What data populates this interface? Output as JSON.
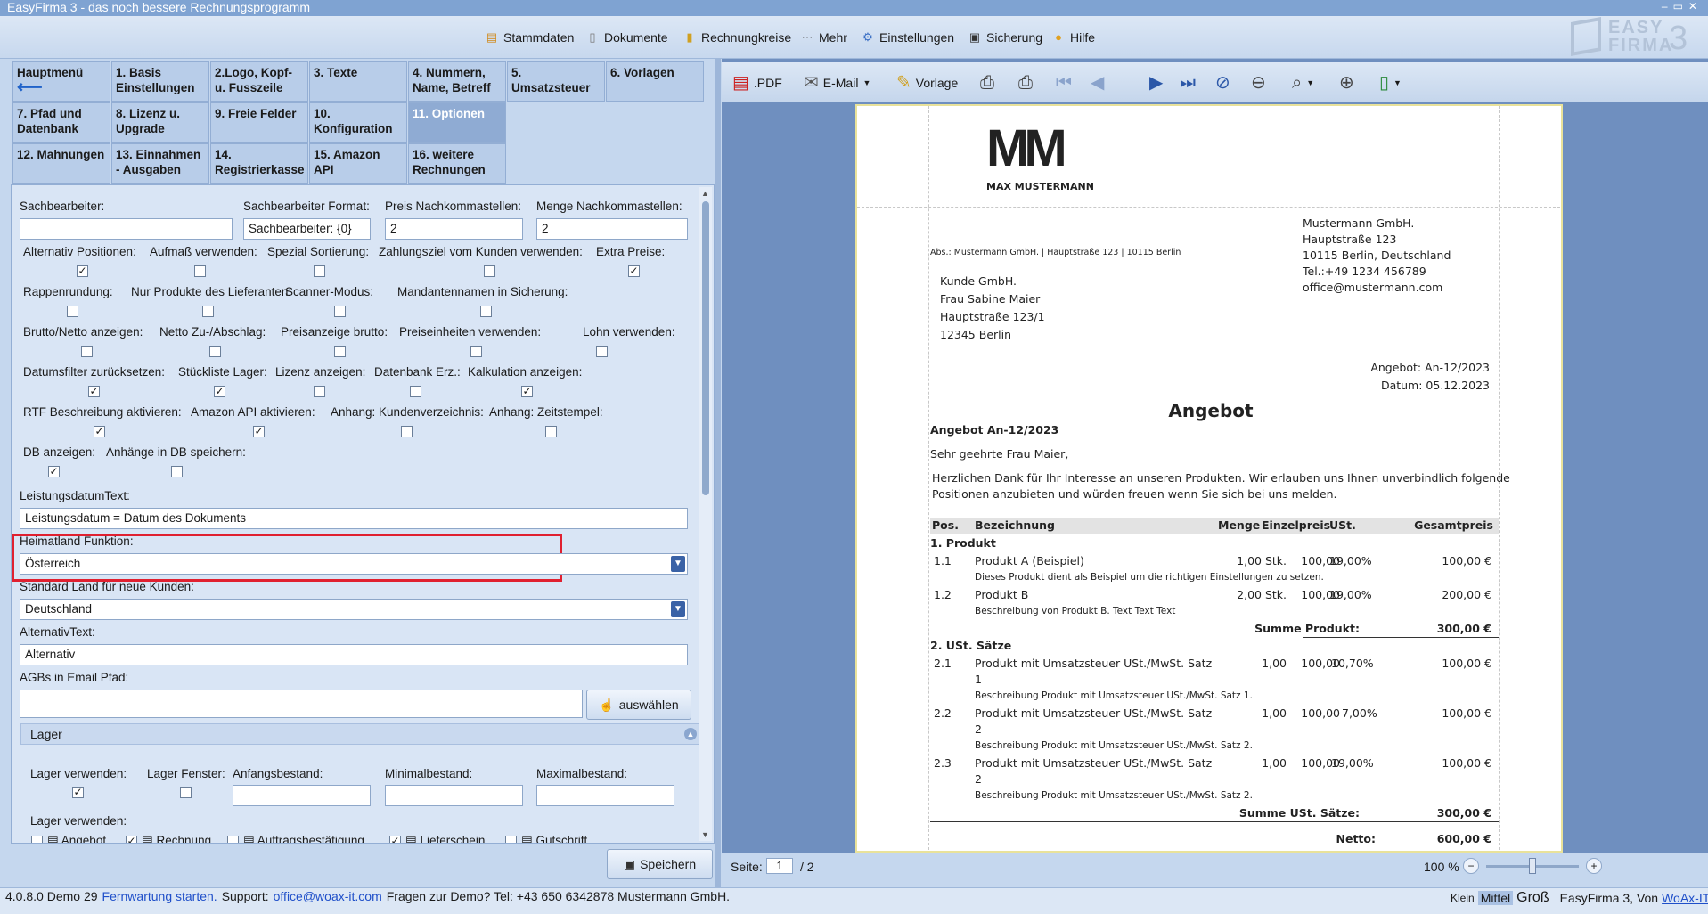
{
  "window": {
    "title": "EasyFirma 3 - das noch bessere Rechnungsprogramm"
  },
  "menu": [
    {
      "label": "Stammdaten",
      "icon": "stammdaten-icon"
    },
    {
      "label": "Dokumente",
      "icon": "document-icon"
    },
    {
      "label": "Rechnungkreise",
      "icon": "rechnungkreise-icon"
    },
    {
      "label": "Mehr",
      "icon": "more-icon"
    },
    {
      "label": "Einstellungen",
      "icon": "gear-icon"
    },
    {
      "label": "Sicherung",
      "icon": "floppy-icon"
    },
    {
      "label": "Hilfe",
      "icon": "help-icon"
    }
  ],
  "logo": {
    "line1": "EASY",
    "line2": "FIRMA",
    "number": "3"
  },
  "tabs": [
    {
      "label": "Hauptmenü"
    },
    {
      "label": "1. Basis Einstellungen"
    },
    {
      "label": "2.Logo, Kopf- u. Fusszeile"
    },
    {
      "label": "3. Texte"
    },
    {
      "label": "4. Nummern, Name, Betreff"
    },
    {
      "label": "5. Umsatzsteuer"
    },
    {
      "label": "6. Vorlagen"
    },
    {
      "label": "7. Pfad und Datenbank"
    },
    {
      "label": "8. Lizenz u. Upgrade"
    },
    {
      "label": "9. Freie Felder"
    },
    {
      "label": "10. Konfiguration"
    },
    {
      "label": "11. Optionen"
    },
    {
      "label": "12. Mahnungen"
    },
    {
      "label": "13. Einnahmen - Ausgaben"
    },
    {
      "label": "14. Registrierkasse"
    },
    {
      "label": "15. Amazon API"
    },
    {
      "label": "16. weitere Rechnungen"
    }
  ],
  "form": {
    "sachbearbeiter_label": "Sachbearbeiter:",
    "sachbearbeiter_value": "",
    "sb_format_label": "Sachbearbeiter Format:",
    "sb_format_value": "Sachbearbeiter: {0}",
    "preis_nk_label": "Preis Nachkommastellen:",
    "preis_nk_value": "2",
    "menge_nk_label": "Menge Nachkommastellen:",
    "menge_nk_value": "2",
    "checks_row1": [
      {
        "label": "Alternativ Positionen:",
        "checked": "✓"
      },
      {
        "label": "Aufmaß verwenden:",
        "checked": ""
      },
      {
        "label": "Spezial Sortierung:",
        "checked": ""
      },
      {
        "label": "Zahlungsziel vom Kunden verwenden:",
        "checked": ""
      },
      {
        "label": "Extra Preise:",
        "checked": "✓"
      }
    ],
    "checks_row2": [
      {
        "label": "Rappenrundung:",
        "checked": ""
      },
      {
        "label": "Nur Produkte des Lieferanten:",
        "checked": ""
      },
      {
        "label": "Scanner-Modus:",
        "checked": ""
      },
      {
        "label": "Mandantennamen in Sicherung:",
        "checked": ""
      }
    ],
    "checks_row3": [
      {
        "label": "Brutto/Netto anzeigen:",
        "checked": ""
      },
      {
        "label": "Netto Zu-/Abschlag:",
        "checked": ""
      },
      {
        "label": "Preisanzeige brutto:",
        "checked": ""
      },
      {
        "label": "Preiseinheiten verwenden:",
        "checked": ""
      },
      {
        "label": "Lohn verwenden:",
        "checked": ""
      }
    ],
    "checks_row4": [
      {
        "label": "Datumsfilter zurücksetzen:",
        "checked": "✓"
      },
      {
        "label": "Stückliste Lager:",
        "checked": "✓"
      },
      {
        "label": "Lizenz anzeigen:",
        "checked": ""
      },
      {
        "label": "Datenbank Erz.:",
        "checked": ""
      },
      {
        "label": "Kalkulation anzeigen:",
        "checked": "✓"
      }
    ],
    "checks_row5": [
      {
        "label": "RTF Beschreibung aktivieren:",
        "checked": "✓"
      },
      {
        "label": "Amazon API aktivieren:",
        "checked": "✓"
      },
      {
        "label": "Anhang: Kundenverzeichnis:",
        "checked": ""
      },
      {
        "label": "Anhang: Zeitstempel:",
        "checked": ""
      }
    ],
    "checks_row6": [
      {
        "label": "DB anzeigen:",
        "checked": "✓"
      },
      {
        "label": "Anhänge in DB speichern:",
        "checked": ""
      }
    ],
    "leistungsdatum_label": "LeistungsdatumText:",
    "leistungsdatum_value": "Leistungsdatum = Datum des Dokuments",
    "heimatland_label": "Heimatland Funktion:",
    "heimatland_value": "Österreich",
    "standardland_label": "Standard Land für neue Kunden:",
    "standardland_value": "Deutschland",
    "alternativtext_label": "AlternativText:",
    "alternativtext_value": "Alternativ",
    "agb_label": "AGBs in Email Pfad:",
    "agb_value": "",
    "auswaehlen_label": "auswählen",
    "lager_header": "Lager",
    "lager_verwenden_label": "Lager verwenden:",
    "lager_fenster_label": "Lager Fenster:",
    "anfangsbestand_label": "Anfangsbestand:",
    "minimalbestand_label": "Minimalbestand:",
    "maximalbestand_label": "Maximalbestand:",
    "lager_verwenden2_label": "Lager verwenden:",
    "lager_docs": [
      {
        "label": "Angebot",
        "checked": ""
      },
      {
        "label": "Rechnung",
        "checked": "✓"
      },
      {
        "label": "Auftragsbestätigung",
        "checked": ""
      },
      {
        "label": "Lieferschein",
        "checked": "✓"
      },
      {
        "label": "Gutschrift",
        "checked": ""
      }
    ],
    "speichern_label": "Speichern"
  },
  "preview_toolbar": {
    "pdf": ".PDF",
    "email": "E-Mail",
    "vorlage": "Vorlage"
  },
  "document": {
    "logo_text": "MM",
    "logo_sub": "MAX MUSTERMANN",
    "sender_line": "Abs.: Mustermann GmbH. | Hauptstraße 123 | 10115 Berlin",
    "company": [
      "Mustermann GmbH.",
      "Hauptstraße 123",
      "10115 Berlin, Deutschland",
      "Tel.:+49 1234 456789",
      "office@mustermann.com"
    ],
    "recipient": [
      "Kunde GmbH.",
      "Frau Sabine Maier",
      "Hauptstraße 123/1",
      "12345 Berlin"
    ],
    "angebot_nr_line": "Angebot: An-12/2023",
    "datum_line": "Datum: 05.12.2023",
    "heading": "Angebot",
    "subheading": "Angebot An-12/2023",
    "salutation": "Sehr geehrte Frau Maier,",
    "intro1": "Herzlichen Dank für Ihr Interesse an unseren Produkten. Wir erlauben uns Ihnen unverbindlich folgende",
    "intro2": "Positionen anzubieten und würden freuen wenn Sie sich bei uns melden.",
    "table_headers": {
      "pos": "Pos.",
      "bez": "Bezeichnung",
      "menge": "Menge",
      "einzel": "Einzelpreis",
      "ust": "USt.",
      "gesamt": "Gesamtpreis"
    },
    "group1": "1. Produkt",
    "rows1": [
      {
        "pos": "1.1",
        "bez": "Produkt A (Beispiel)",
        "menge": "1,00 Stk.",
        "einzel": "100,00",
        "ust": "19,00%",
        "gesamt": "100,00 €",
        "desc": "Dieses Produkt dient als Beispiel um die richtigen Einstellungen zu setzen."
      },
      {
        "pos": "1.2",
        "bez": "Produkt B",
        "menge": "2,00 Stk.",
        "einzel": "100,00",
        "ust": "19,00%",
        "gesamt": "200,00 €",
        "desc": "Beschreibung von Produkt B. Text Text Text"
      }
    ],
    "sum1_label": "Summe Produkt:",
    "sum1_value": "300,00 €",
    "group2": "2. USt. Sätze",
    "rows2": [
      {
        "pos": "2.1",
        "bez": "Produkt mit Umsatzsteuer USt./MwSt. Satz",
        "bez2": "1",
        "menge": "1,00",
        "einzel": "100,00",
        "ust": "10,70%",
        "gesamt": "100,00 €",
        "desc": "Beschreibung Produkt mit Umsatzsteuer USt./MwSt. Satz 1."
      },
      {
        "pos": "2.2",
        "bez": "Produkt mit Umsatzsteuer USt./MwSt. Satz",
        "bez2": "2",
        "menge": "1,00",
        "einzel": "100,00",
        "ust": "7,00%",
        "gesamt": "100,00 €",
        "desc": "Beschreibung Produkt mit Umsatzsteuer USt./MwSt. Satz 2."
      },
      {
        "pos": "2.3",
        "bez": "Produkt mit Umsatzsteuer USt./MwSt. Satz",
        "bez2": "2",
        "menge": "1,00",
        "einzel": "100,00",
        "ust": "19,00%",
        "gesamt": "100,00 €",
        "desc": "Beschreibung Produkt mit Umsatzsteuer USt./MwSt. Satz 2."
      }
    ],
    "sum2_label": "Summe USt. Sätze:",
    "sum2_value": "300,00 €",
    "netto_label": "Netto:",
    "netto_value": "600,00 €"
  },
  "pager": {
    "label": "Seite:",
    "current": "1",
    "total": "/ 2",
    "zoom": "100 %"
  },
  "statusbar": {
    "version": "4.0.8.0 Demo 29",
    "fernwartung": "Fernwartung starten.",
    "support_label": "Support:",
    "support_email": "office@woax-it.com",
    "demo_text": "Fragen zur Demo? Tel: +43 650 6342878 Mustermann GmbH.",
    "size_klein": "Klein",
    "size_mittel": "Mittel",
    "size_gross": "Groß",
    "credit": "EasyFirma 3, Von",
    "credit_link": "WoAx-IT"
  }
}
